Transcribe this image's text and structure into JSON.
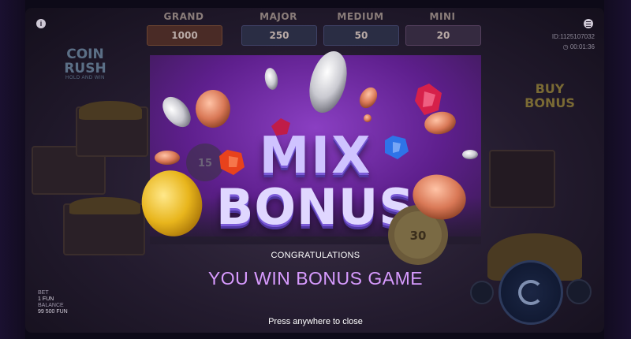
{
  "jackpots": [
    {
      "name": "GRAND",
      "value": "1000"
    },
    {
      "name": "MAJOR",
      "value": "250"
    },
    {
      "name": "MEDIUM",
      "value": "50"
    },
    {
      "name": "MINI",
      "value": "20"
    }
  ],
  "session": {
    "id": "ID:1125107032",
    "time": "00:01:36"
  },
  "logo": {
    "line1": "COIN",
    "line2": "RUSH",
    "line3": "HOLD AND WIN"
  },
  "buy_bonus": {
    "line1": "BUY",
    "line2": "BONUS"
  },
  "bonus_title": {
    "line1": "MIX",
    "line2": "BONUS"
  },
  "message": {
    "congrats": "CONGRATULATIONS",
    "win": "YOU WIN BONUS GAME",
    "close_hint": "Press anywhere to close"
  },
  "wallet": {
    "bet_label": "BET",
    "bet_value": "1 FUN",
    "balance_label": "BALANCE",
    "balance_value": "99 500 FUN"
  },
  "reel_values": [
    "15",
    "30"
  ],
  "icons": {
    "info": "info-icon",
    "menu": "menu-icon",
    "clock": "clock-icon",
    "spin": "spin-icon",
    "autoplay": "autoplay-icon"
  },
  "colors": {
    "bonus_purple": "#8a3fc2",
    "win_text": "#d89bff",
    "gold_coin": "#e8b51c",
    "copper_coin": "#d97856",
    "silver_coin": "#c9c9d0"
  }
}
